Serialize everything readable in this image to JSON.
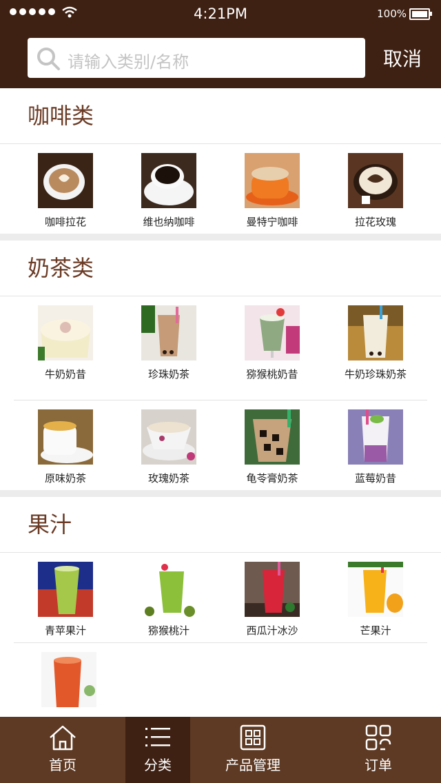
{
  "status": {
    "time": "4:21PM",
    "battery": "100%"
  },
  "search": {
    "placeholder": "请输入类别/名称",
    "cancel": "取消"
  },
  "sections": [
    {
      "title": "咖啡类",
      "items": [
        "咖啡拉花",
        "维也纳咖啡",
        "曼特宁咖啡",
        "拉花玫瑰"
      ]
    },
    {
      "title": "奶茶类",
      "items": [
        "牛奶奶昔",
        "珍珠奶茶",
        "猕猴桃奶昔",
        "牛奶珍珠奶茶",
        "原味奶茶",
        "玫瑰奶茶",
        "龟苓膏奶茶",
        "蓝莓奶昔"
      ]
    },
    {
      "title": "果汁",
      "items": [
        "青苹果汁",
        "猕猴桃汁",
        "西瓜汁冰沙",
        "芒果汁",
        ""
      ]
    }
  ],
  "tabs": [
    "首页",
    "分类",
    "产品管理",
    "订单"
  ],
  "colors": {
    "brand_dark": "#3f2113",
    "brand_mid": "#5e3a24",
    "title": "#6a3a24"
  }
}
